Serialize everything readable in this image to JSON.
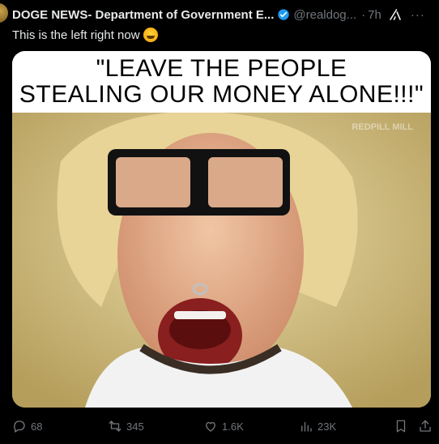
{
  "post": {
    "author_name": "DOGE NEWS- Department of Government E...",
    "handle": "@realdog...",
    "separator": "·",
    "time": "7h",
    "text": "This is the left right now",
    "more": "···"
  },
  "media": {
    "caption_line1": "\"LEAVE THE PEOPLE",
    "caption_line2": "STEALING OUR MONEY ALONE!!!\"",
    "watermark": "REDPILL MILL"
  },
  "actions": {
    "replies": "68",
    "reposts": "345",
    "likes": "1.6K",
    "views": "23K"
  },
  "colors": {
    "background": "#000000",
    "text": "#e7e9ea",
    "muted": "#71767b",
    "verified": "#1d9bf0"
  }
}
